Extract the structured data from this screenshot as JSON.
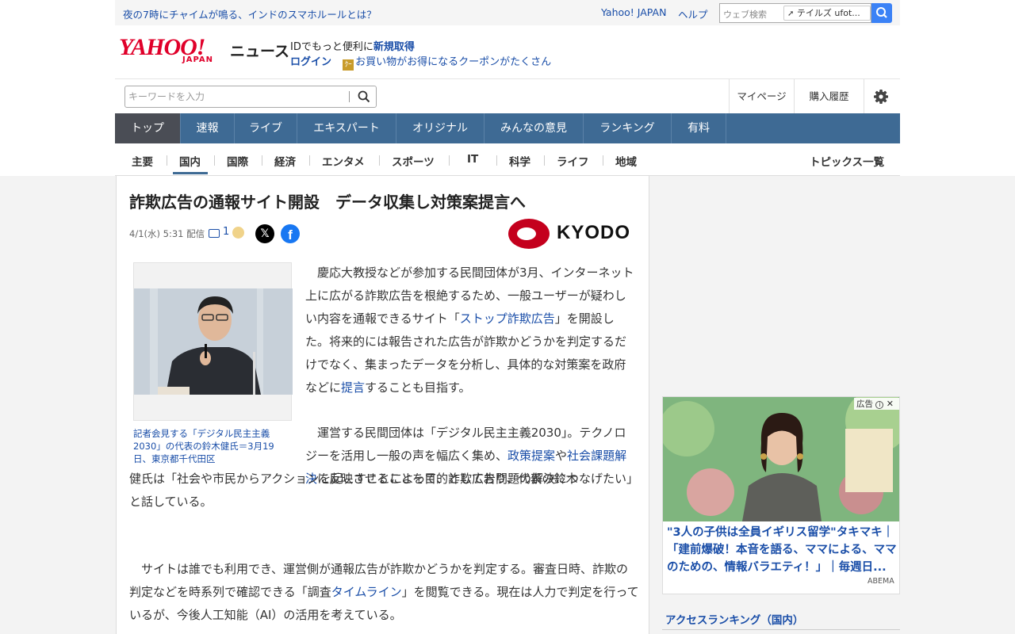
{
  "topbar": {
    "promo_link": "夜の7時にチャイムが鳴る、インドのスマホルールとは？",
    "yahoo_japan": "Yahoo! JAPAN",
    "help": "ヘルプ",
    "web_search_placeholder": "ウェブ検索",
    "search_chip": "テイルズ ufot..."
  },
  "header": {
    "logo_text": "YAHOO!",
    "logo_sub": "JAPAN",
    "section": "ニュース",
    "id_promo": "IDでもっと便利に",
    "register": "新規取得",
    "login": "ログイン",
    "coupon_icon_text": "ｸｰ",
    "coupon": "お買い物がお得になるクーポンがたくさん"
  },
  "search": {
    "placeholder": "キーワードを入力"
  },
  "user_nav": {
    "mypage": "マイページ",
    "purchase_history": "購入履歴"
  },
  "main_nav": [
    {
      "label": "トップ"
    },
    {
      "label": "速報"
    },
    {
      "label": "ライブ"
    },
    {
      "label": "エキスパート"
    },
    {
      "label": "オリジナル"
    },
    {
      "label": "みんなの意見"
    },
    {
      "label": "ランキング"
    },
    {
      "label": "有料"
    }
  ],
  "sub_nav": [
    {
      "label": "主要"
    },
    {
      "label": "国内"
    },
    {
      "label": "国際"
    },
    {
      "label": "経済"
    },
    {
      "label": "エンタメ"
    },
    {
      "label": "スポーツ"
    },
    {
      "label": "IT"
    },
    {
      "label": "科学"
    },
    {
      "label": "ライフ"
    },
    {
      "label": "地域"
    }
  ],
  "topics_list": "トピックス一覧",
  "article": {
    "headline": "詐欺広告の通報サイト開設　データ収集し対策案提言へ",
    "date": "4/1(水) 5:31 配信",
    "comment_count": "1",
    "share_x": "𝕏",
    "share_fb": "f",
    "source": "KYODO",
    "photo_caption": "記者会見する「デジタル民主主義2030」の代表の鈴木健氏＝3月19日、東京都千代田区",
    "p1_a": "　慶応大教授などが参加する民間団体が3月、インターネット上に広がる詐欺広告を根絶するため、一般ユーザーが疑わしい内容を通報できるサイト「",
    "p1_link1": "ストップ詐欺広告",
    "p1_b": "」を開設した。将来的には報告された広告が詐欺かどうかを判定するだけでなく、集まったデータを分析し、具体的な対策案を政府などに",
    "p1_link2": "提言",
    "p1_c": "することも目指す。",
    "p2_a": "　運営する民間団体は「デジタル民主主義2030」。テクノロジーを活用し一般の声を幅広く集め、",
    "p2_link1": "政策提案",
    "p2_b": "や",
    "p2_link2a": "社会",
    "p2_link2b": "課題解決",
    "p2_c": "に反映させることを目的としており、代表の鈴木",
    "p2_d": "健氏は「社会や市民からアクションを起こすことによって、詐欺広告問題の解決につなげたい」と話している。",
    "p3_a": "　サイトは誰でも利用でき、運営側が通報広告が詐欺かどうかを判定する。審査日時、詐欺の判定などを時系列で確認できる「調査",
    "p3_link": "タイムライン",
    "p3_b": "」を閲覧できる。現在は人力で判定を行っているが、今後人工知能（AI）の活用を考えている。"
  },
  "ad": {
    "label": "広告",
    "headline": "\"3人の子供は全員イギリス留学\"タキマキ｜「建前爆破！本音を語る、ママによる、ママのための、情報バラエティ！」｜毎週日...",
    "brand": "ABEMA"
  },
  "ranking": {
    "title": "アクセスランキング（国内）"
  },
  "colors": {
    "nav_bg": "#3e6a94",
    "nav_active": "#4a4d55",
    "link": "#1a4ea8",
    "brand_red": "#e0002a"
  }
}
